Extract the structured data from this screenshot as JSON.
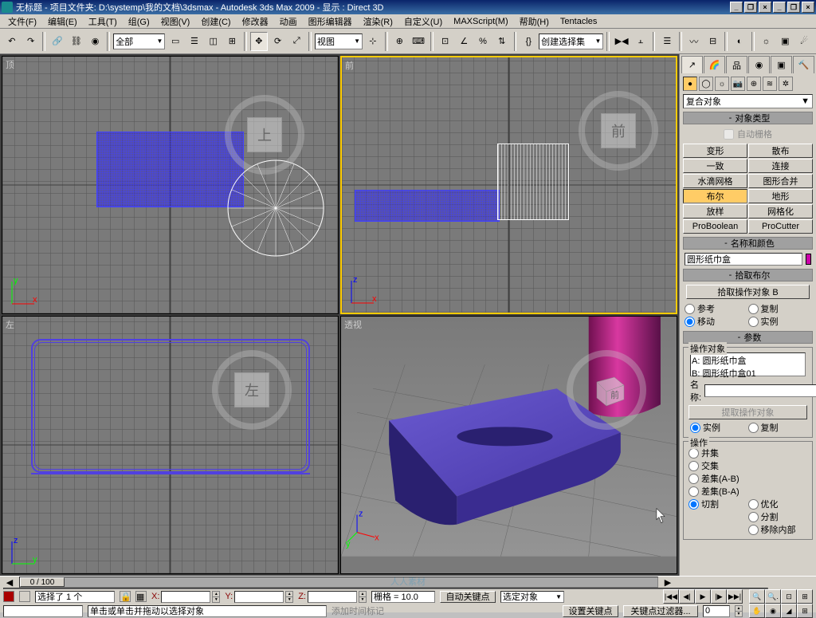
{
  "title": "无标题    - 项目文件夹: D:\\systemp\\我的文档\\3dsmax      - Autodesk 3ds Max 2009      - 显示 : Direct 3D",
  "menu": [
    "文件(F)",
    "编辑(E)",
    "工具(T)",
    "组(G)",
    "视图(V)",
    "创建(C)",
    "修改器",
    "动画",
    "图形编辑器",
    "渲染(R)",
    "自定义(U)",
    "MAXScript(M)",
    "帮助(H)",
    "Tentacles"
  ],
  "toolbar": {
    "filter": "全部",
    "view_label": "视图",
    "selset_label": "创建选择集"
  },
  "viewports": {
    "top": "顶",
    "front": "前",
    "left": "左",
    "persp": "透视",
    "cube_top": "上",
    "cube_front": "前",
    "cube_left": "左"
  },
  "panel": {
    "category": "复合对象",
    "obj_type_hdr": "对象类型",
    "autogrid": "自动栅格",
    "types": [
      [
        "变形",
        "散布"
      ],
      [
        "一致",
        "连接"
      ],
      [
        "水滴网格",
        "图形合并"
      ],
      [
        "布尔",
        "地形"
      ],
      [
        "放样",
        "网格化"
      ],
      [
        "ProBoolean",
        "ProCutter"
      ]
    ],
    "name_hdr": "名称和颜色",
    "obj_name": "圆形纸巾盒",
    "pick_hdr": "拾取布尔",
    "pick_btn": "拾取操作对象 B",
    "pick_opts": [
      "参考",
      "复制",
      "移动",
      "实例"
    ],
    "params_hdr": "参数",
    "operand_lbl": "操作对象",
    "operand_a": "A:  圆形纸巾盒",
    "operand_b": "B:  圆形纸巾盒01",
    "name_lbl": "名称:",
    "extract_btn": "提取操作对象",
    "extract_opts": [
      "实例",
      "复制"
    ],
    "op_lbl": "操作",
    "ops": [
      "并集",
      "交集",
      "差集(A-B)",
      "差集(B-A)",
      "切割"
    ],
    "cut_opts": [
      "优化",
      "分割",
      "移除内部"
    ]
  },
  "status": {
    "frame": "0 / 100",
    "sel": "选择了 1 个",
    "x": "X:",
    "y": "Y:",
    "z": "Z:",
    "grid": "栅格 = 10.0",
    "addtime": "添加时间标记",
    "autokey": "自动关键点",
    "dropdown": "选定对象",
    "hint": "单击或单击并拖动以选择对象",
    "setkey": "设置关键点",
    "keyfilter": "关键点过滤器..."
  },
  "watermark": "人人素材"
}
